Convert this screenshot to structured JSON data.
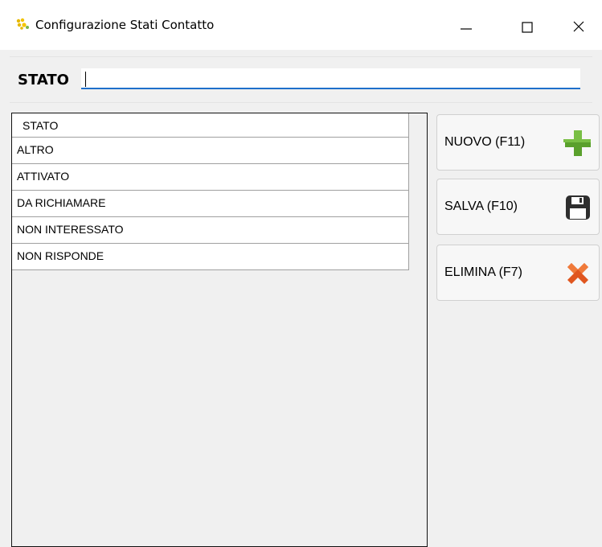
{
  "window": {
    "title": "Configurazione Stati Contatto",
    "controls": [
      "minimize-icon",
      "maximize-icon",
      "close-icon"
    ]
  },
  "form": {
    "stato_label": "STATO",
    "stato_value": ""
  },
  "grid": {
    "column_header": "STATO",
    "rows": [
      "ALTRO",
      "ATTIVATO",
      "DA RICHIAMARE",
      "NON INTERESSATO",
      "NON RISPONDE"
    ]
  },
  "actions": {
    "nuovo": {
      "label": "NUOVO (F11)",
      "icon": "plus-icon",
      "color": "#5aa02c"
    },
    "salva": {
      "label": "SALVA (F10)",
      "icon": "floppy-disk-icon",
      "color": "#2e2e2e"
    },
    "elimina": {
      "label": "ELIMINA (F7)",
      "icon": "delete-x-icon",
      "color": "#e0561f"
    }
  },
  "colors": {
    "input_underline": "#1e6fcb",
    "background": "#f0f0f0"
  }
}
